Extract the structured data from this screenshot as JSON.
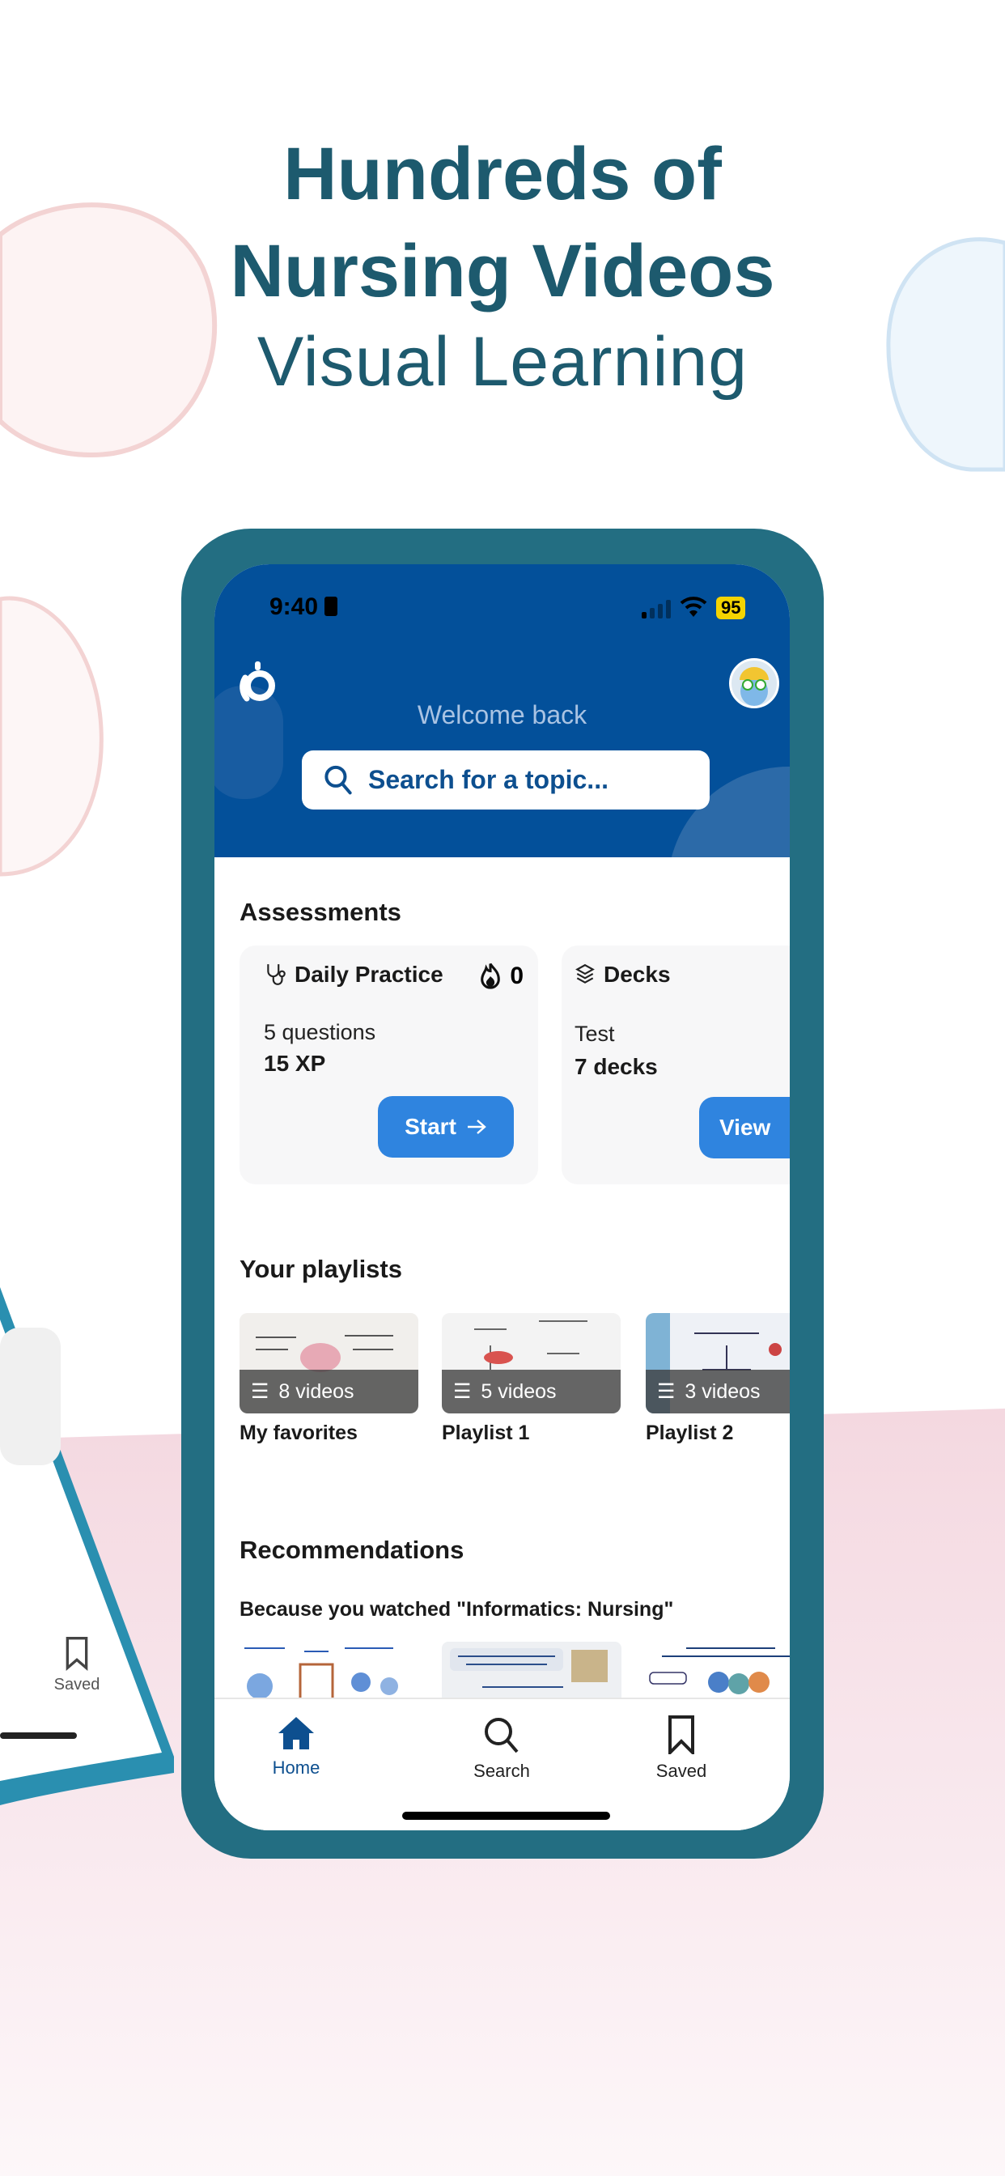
{
  "promo": {
    "headline_line1": "Hundreds of",
    "headline_line2": "Nursing Videos",
    "headline_line3": "Visual Learning",
    "text_color": "#1d5a6e"
  },
  "background_phone": {
    "saved_label": "Saved"
  },
  "status_bar": {
    "time": "9:40",
    "battery": "95"
  },
  "header": {
    "welcome": "Welcome back",
    "search_placeholder": "Search for a topic...",
    "brand_color": "#03509a"
  },
  "assessments": {
    "title": "Assessments",
    "cards": [
      {
        "icon": "stethoscope-icon",
        "title": "Daily Practice",
        "streak": "0",
        "line1": "5 questions",
        "line2": "15 XP",
        "button": "Start"
      },
      {
        "icon": "layers-icon",
        "title": "Decks",
        "line1": "Test",
        "line2": "7 decks",
        "button": "View"
      }
    ],
    "button_color": "#2f84df"
  },
  "playlists": {
    "title": "Your playlists",
    "items": [
      {
        "name": "My favorites",
        "count": "8 videos"
      },
      {
        "name": "Playlist 1",
        "count": "5 videos"
      },
      {
        "name": "Playlist 2",
        "count": "3 videos"
      }
    ]
  },
  "recommendations": {
    "title": "Recommendations",
    "subtitle": "Because you watched \"Informatics: Nursing\""
  },
  "tabbar": {
    "items": [
      {
        "label": "Home",
        "icon": "home-icon",
        "active": true
      },
      {
        "label": "Search",
        "icon": "search-icon",
        "active": false
      },
      {
        "label": "Saved",
        "icon": "bookmark-icon",
        "active": false
      }
    ]
  }
}
